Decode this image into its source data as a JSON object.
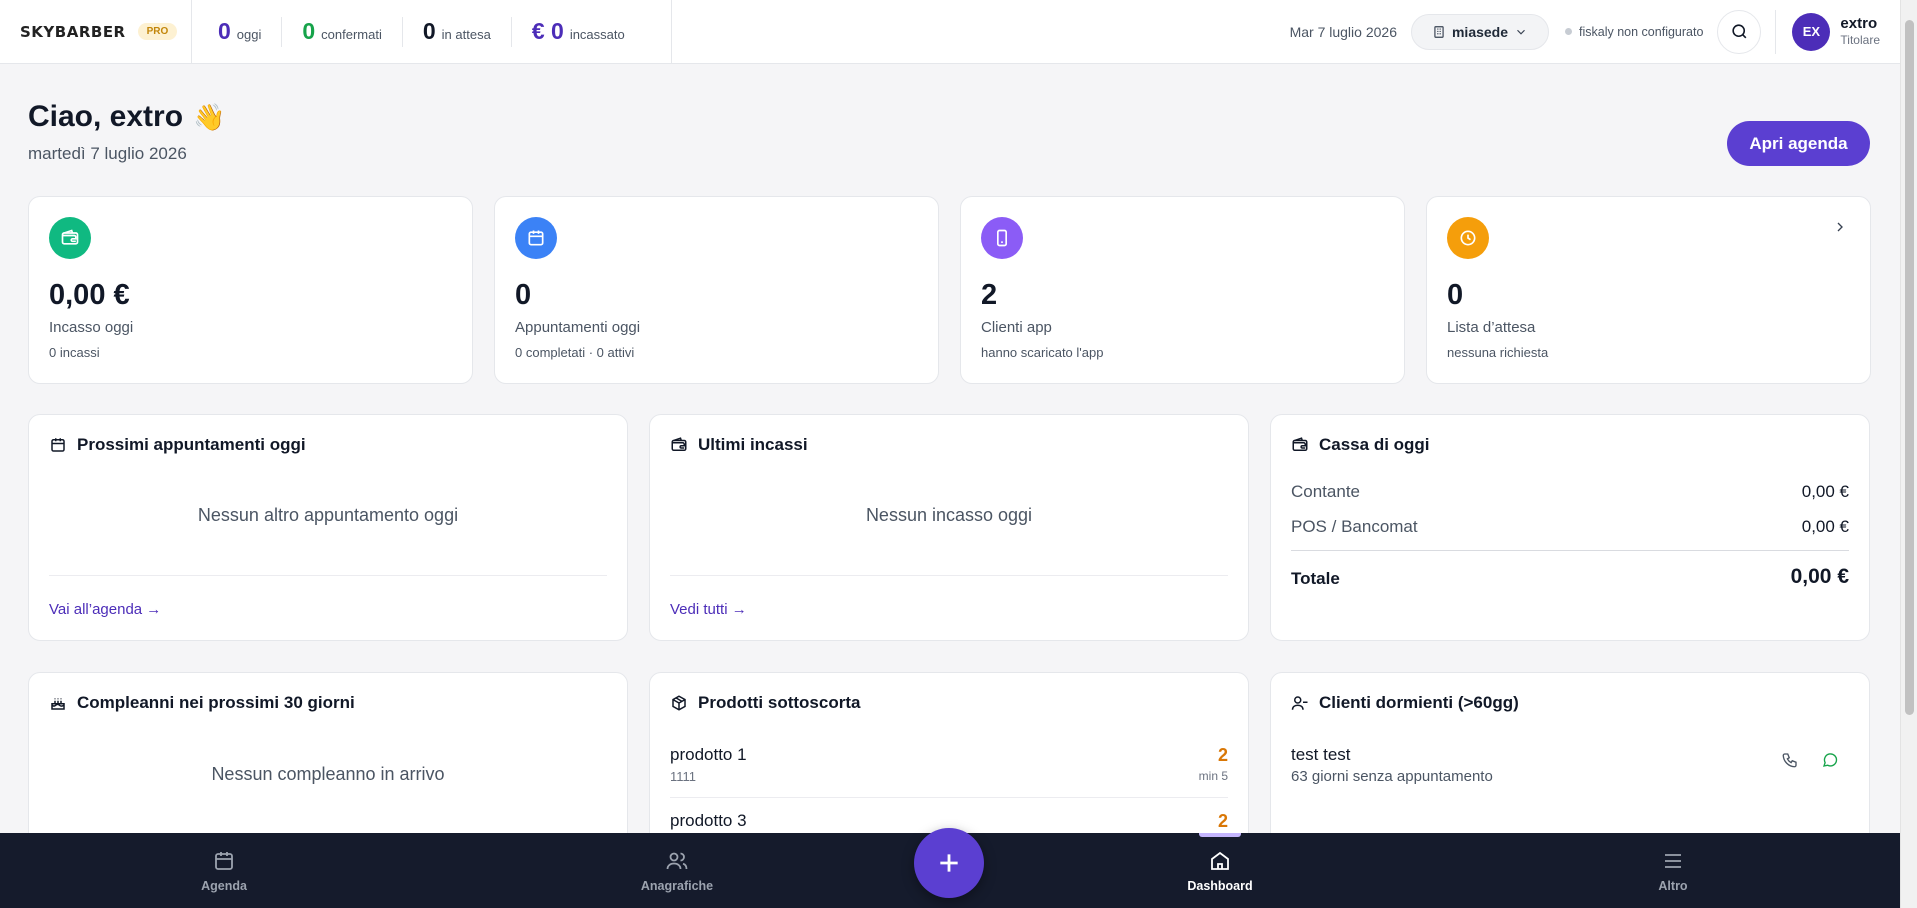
{
  "header": {
    "brand": "SKYBARBER",
    "badge": "PRO",
    "kpis": [
      {
        "value": "0",
        "label": "oggi",
        "color": "#4c2db8"
      },
      {
        "value": "0",
        "label": "confermati",
        "color": "#16a34a"
      },
      {
        "value": "0",
        "label": "in attesa",
        "color": "#111827"
      },
      {
        "value": "€ 0",
        "label": "incassato",
        "color": "#4c2db8"
      }
    ],
    "date": "Mar 7 luglio 2026",
    "sede": "miasede",
    "fiskaly": "fiskaly non configurato",
    "user": {
      "initials": "EX",
      "name": "extro",
      "role": "Titolare"
    }
  },
  "greeting": {
    "title": "Ciao, extro",
    "emoji": "👋",
    "date": "martedì 7 luglio 2026",
    "open_agenda": "Apri agenda"
  },
  "stats": [
    {
      "value": "0,00 €",
      "label": "Incasso oggi",
      "sub": "0 incassi",
      "icon": "wallet-icon",
      "color": "#10b981"
    },
    {
      "value": "0",
      "label": "Appuntamenti oggi",
      "sub": "0 completati · 0 attivi",
      "icon": "calendar-icon",
      "color": "#3b82f6"
    },
    {
      "value": "2",
      "label": "Clienti app",
      "sub": "hanno scaricato l'app",
      "icon": "smartphone-icon",
      "color": "#8b5cf6"
    },
    {
      "value": "0",
      "label": "Lista d’attesa",
      "sub": "nessuna richiesta",
      "icon": "clock-icon",
      "color": "#f59e0b"
    }
  ],
  "panels": {
    "appointments": {
      "title": "Prossimi appuntamenti oggi",
      "empty": "Nessun altro appuntamento oggi",
      "link": "Vai all’agenda →"
    },
    "incassi": {
      "title": "Ultimi incassi",
      "empty": "Nessun incasso oggi",
      "link": "Vedi tutti →"
    },
    "cassa": {
      "title": "Cassa di oggi",
      "rows": [
        {
          "label": "Contante",
          "value": "0,00 €"
        },
        {
          "label": "POS / Bancomat",
          "value": "0,00 €"
        }
      ],
      "total_label": "Totale",
      "total_value": "0,00 €"
    },
    "birthdays": {
      "title": "Compleanni nei prossimi 30 giorni",
      "empty": "Nessun compleanno in arrivo"
    },
    "products": {
      "title": "Prodotti sottoscorta",
      "items": [
        {
          "name": "prodotto 1",
          "code": "1111",
          "qty": "2",
          "min": "min 5"
        },
        {
          "name": "prodotto 3",
          "code": "",
          "qty": "2",
          "min": ""
        }
      ]
    },
    "dormant": {
      "title": "Clienti dormienti (>60gg)",
      "clients": [
        {
          "name": "test test",
          "detail": "63 giorni senza appuntamento"
        }
      ]
    }
  },
  "nav": {
    "items": [
      {
        "label": "Agenda"
      },
      {
        "label": "Anagrafiche"
      },
      {
        "label": "Dashboard"
      },
      {
        "label": "Altro"
      }
    ],
    "active": "Dashboard"
  }
}
